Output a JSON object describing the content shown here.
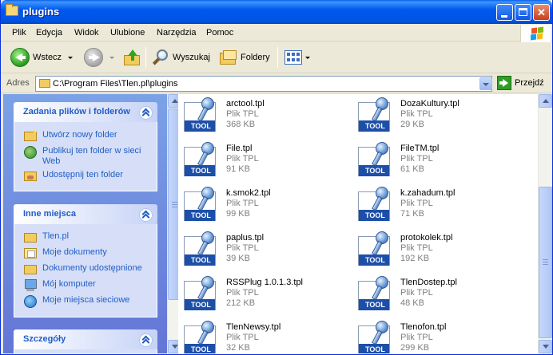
{
  "window": {
    "title": "plugins"
  },
  "menu": [
    "Plik",
    "Edycja",
    "Widok",
    "Ulubione",
    "Narzędzia",
    "Pomoc"
  ],
  "toolbar": {
    "back_label": "Wstecz",
    "search_label": "Wyszukaj",
    "folders_label": "Foldery"
  },
  "address": {
    "label": "Adres",
    "value": "C:\\Program Files\\Tlen.pl\\plugins",
    "go_label": "Przejdź"
  },
  "taskpane": {
    "file_tasks": {
      "title": "Zadania plików i folderów",
      "items": [
        "Utwórz nowy folder",
        "Publikuj ten folder w sieci Web",
        "Udostępnij ten folder"
      ]
    },
    "other_places": {
      "title": "Inne miejsca",
      "items": [
        "Tlen.pl",
        "Moje dokumenty",
        "Dokumenty udostępnione",
        "Mój komputer",
        "Moje miejsca sieciowe"
      ]
    },
    "details": {
      "title": "Szczegóły"
    }
  },
  "files": [
    {
      "name": "arctool.tpl",
      "type": "Plik TPL",
      "size": "368 KB"
    },
    {
      "name": "DozaKultury.tpl",
      "type": "Plik TPL",
      "size": "29 KB"
    },
    {
      "name": "File.tpl",
      "type": "Plik TPL",
      "size": "91 KB"
    },
    {
      "name": "FileTM.tpl",
      "type": "Plik TPL",
      "size": "61 KB"
    },
    {
      "name": "k.smok2.tpl",
      "type": "Plik TPL",
      "size": "99 KB"
    },
    {
      "name": "k.zahadum.tpl",
      "type": "Plik TPL",
      "size": "71 KB"
    },
    {
      "name": "paplus.tpl",
      "type": "Plik TPL",
      "size": "39 KB"
    },
    {
      "name": "protokolek.tpl",
      "type": "Plik TPL",
      "size": "192 KB"
    },
    {
      "name": "RSSPlug 1.0.1.3.tpl",
      "type": "Plik TPL",
      "size": "212 KB"
    },
    {
      "name": "TlenDostep.tpl",
      "type": "Plik TPL",
      "size": "48 KB"
    },
    {
      "name": "TlenNewsy.tpl",
      "type": "Plik TPL",
      "size": "32 KB"
    },
    {
      "name": "Tlenofon.tpl",
      "type": "Plik TPL",
      "size": "299 KB"
    }
  ],
  "file_icon_label": "TOOL"
}
